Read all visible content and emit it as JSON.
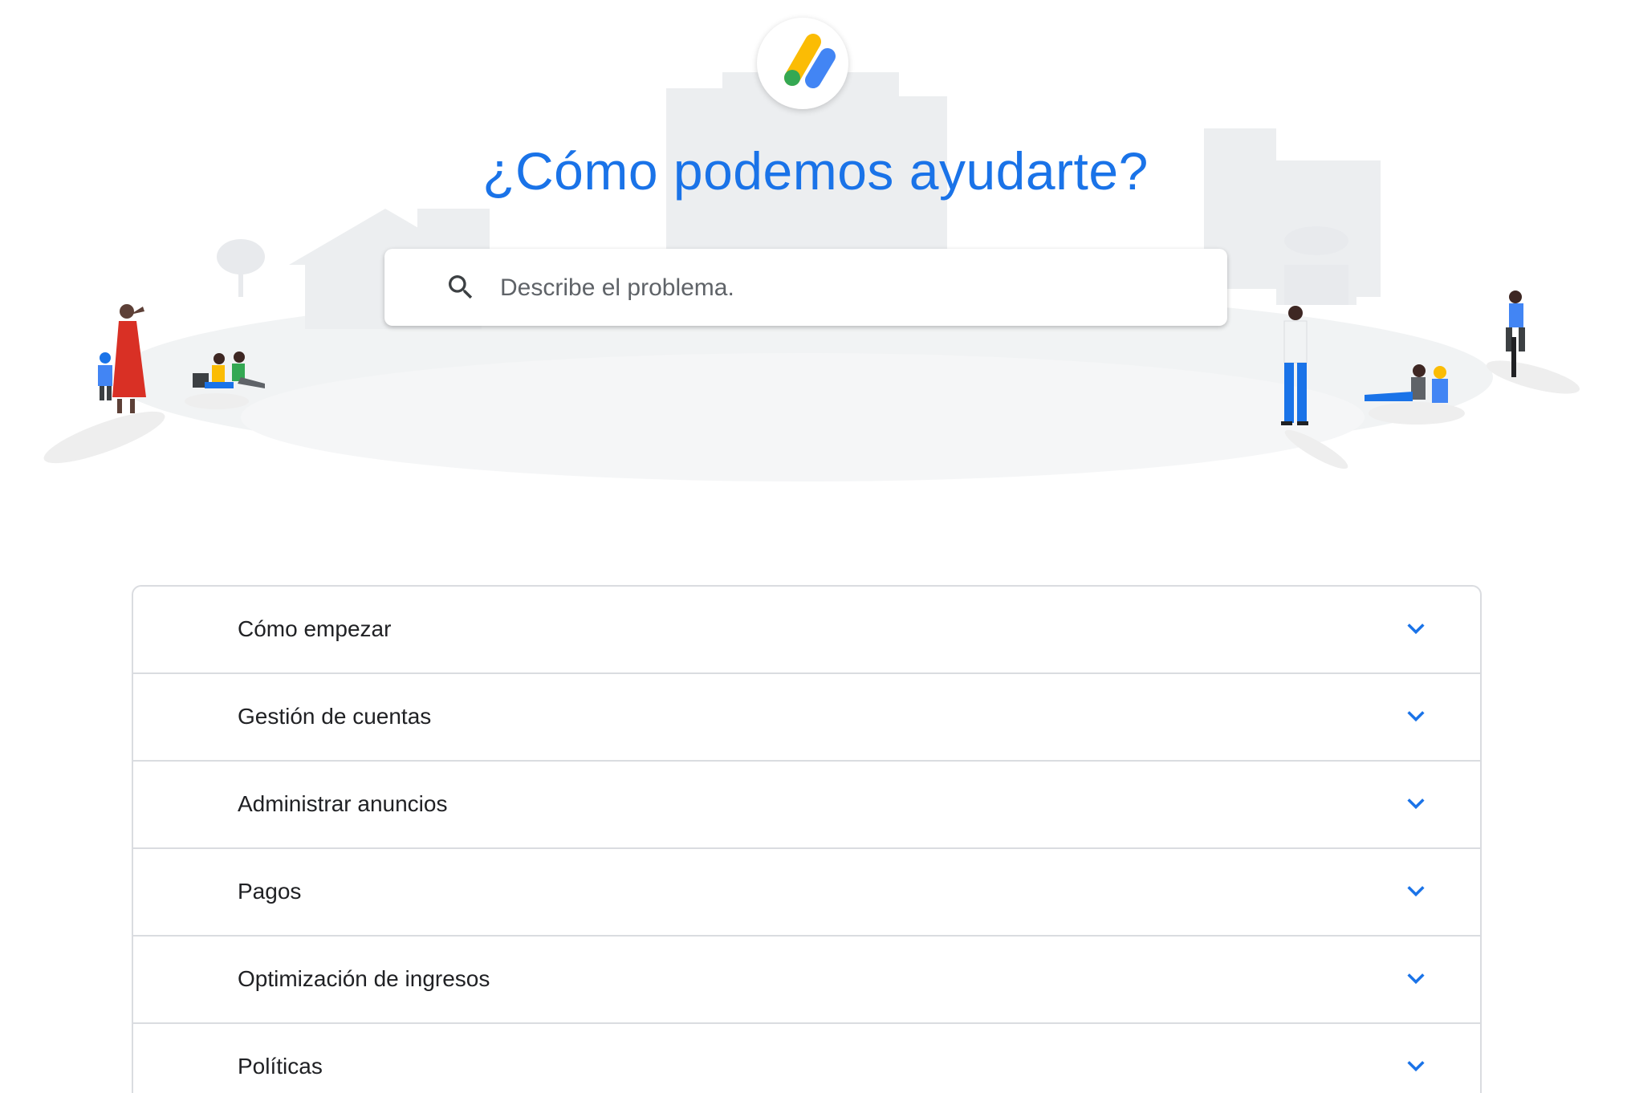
{
  "header": {
    "logo_icon": "adsense-logo-icon",
    "title": "¿Cómo podemos ayudarte?"
  },
  "search": {
    "placeholder": "Describe el problema.",
    "icon": "search-icon"
  },
  "topics": [
    {
      "label": "Cómo empezar",
      "icon": "chevron-down-icon"
    },
    {
      "label": "Gestión de cuentas",
      "icon": "chevron-down-icon"
    },
    {
      "label": "Administrar anuncios",
      "icon": "chevron-down-icon"
    },
    {
      "label": "Pagos",
      "icon": "chevron-down-icon"
    },
    {
      "label": "Optimización de ingresos",
      "icon": "chevron-down-icon"
    },
    {
      "label": "Políticas",
      "icon": "chevron-down-icon"
    }
  ],
  "colors": {
    "accent": "#1a73e8",
    "logo_yellow": "#fbbc04",
    "logo_green": "#34a853",
    "logo_blue": "#4285f4"
  }
}
